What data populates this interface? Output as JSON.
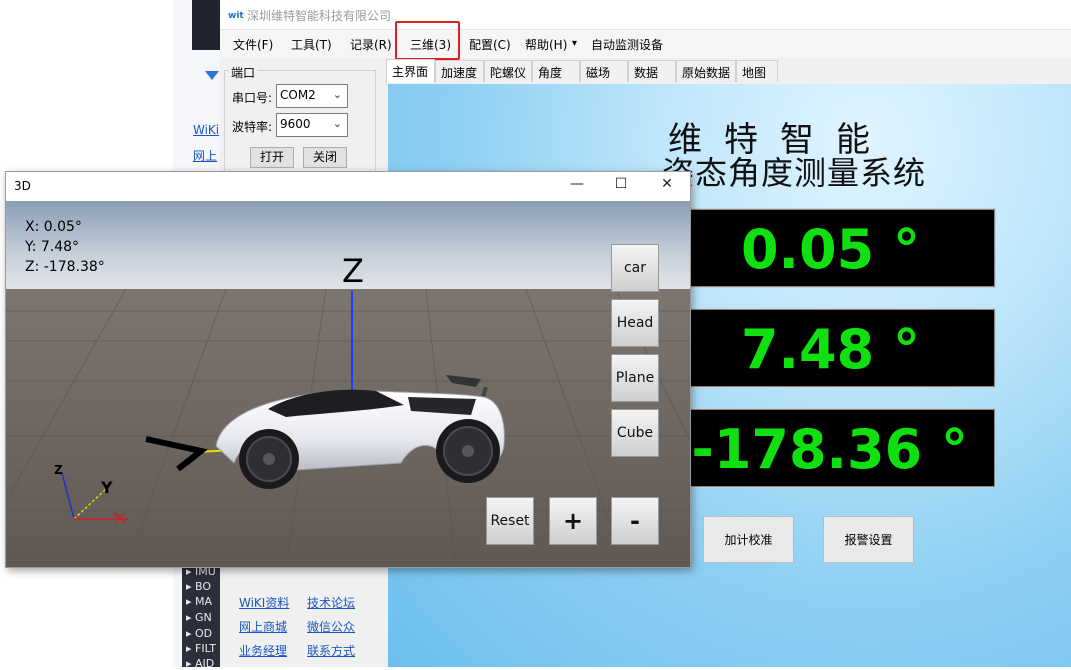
{
  "background": {
    "links": [
      "WiKi",
      "网上"
    ]
  },
  "app": {
    "title": "深圳维特智能科技有限公司",
    "menu": [
      "文件(F)",
      "工具(T)",
      "记录(R)",
      "三维(3)",
      "配置(C)",
      "帮助(H)",
      "▾",
      "自动监测设备"
    ],
    "port_group": {
      "label": "端口",
      "port_label": "串口号:",
      "port_value": "COM2",
      "baud_label": "波特率:",
      "baud_value": "9600",
      "open_button": "打开",
      "close_button": "关闭"
    },
    "tabs": [
      "主界面",
      "加速度",
      "陀螺仪",
      "角度",
      "磁场",
      "数据",
      "原始数据",
      "地图"
    ],
    "main": {
      "title_line1": "维特智能",
      "title_line2": "姿态角度测量系统",
      "readouts": [
        "0.05 °",
        "7.48 °",
        "-178.36 °"
      ],
      "calibrate_button": "加计校准",
      "alarm_button": "报警设置"
    },
    "tree": [
      "▸ IMU",
      "▸ BO",
      "▸ MA",
      "▸ GN",
      "▸ OD",
      "▸ FILT",
      "▸ AID"
    ],
    "links": [
      "WiKI资料",
      "技术论坛",
      "网上商城",
      "微信公众",
      "业务经理",
      "联系方式"
    ]
  },
  "win3d": {
    "title": "3D",
    "controls": {
      "minimize": "—",
      "maximize": "☐",
      "close": "✕"
    },
    "coords": {
      "x": "X:  0.05°",
      "y": "Y:  7.48°",
      "z": "Z:  -178.38°"
    },
    "axis_labels": {
      "z_top": "Z",
      "z_small": "Z",
      "y_small": "Y"
    },
    "buttons": {
      "car": "car",
      "head": "Head",
      "plane": "Plane",
      "cube": "Cube",
      "reset": "Reset",
      "plus": "+",
      "minus": "-"
    }
  },
  "colors": {
    "readout_green": "#10e010",
    "highlight_red": "#e02020",
    "link_blue": "#1a56c4"
  }
}
